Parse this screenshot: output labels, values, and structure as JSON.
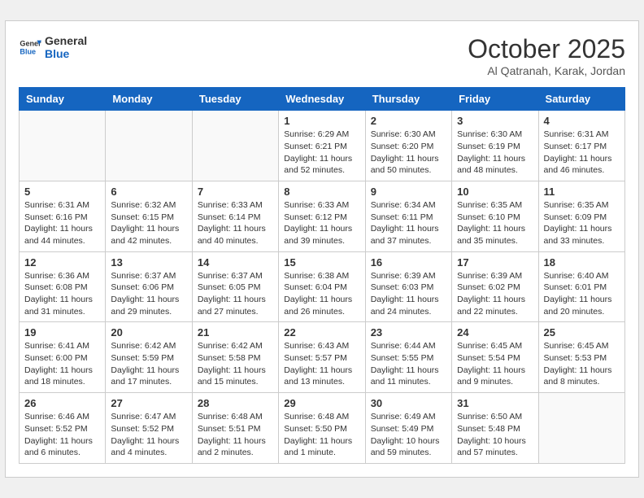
{
  "header": {
    "logo_line1": "General",
    "logo_line2": "Blue",
    "month_title": "October 2025",
    "location": "Al Qatranah, Karak, Jordan"
  },
  "days_of_week": [
    "Sunday",
    "Monday",
    "Tuesday",
    "Wednesday",
    "Thursday",
    "Friday",
    "Saturday"
  ],
  "weeks": [
    [
      {
        "day": "",
        "info": ""
      },
      {
        "day": "",
        "info": ""
      },
      {
        "day": "",
        "info": ""
      },
      {
        "day": "1",
        "info": "Sunrise: 6:29 AM\nSunset: 6:21 PM\nDaylight: 11 hours\nand 52 minutes."
      },
      {
        "day": "2",
        "info": "Sunrise: 6:30 AM\nSunset: 6:20 PM\nDaylight: 11 hours\nand 50 minutes."
      },
      {
        "day": "3",
        "info": "Sunrise: 6:30 AM\nSunset: 6:19 PM\nDaylight: 11 hours\nand 48 minutes."
      },
      {
        "day": "4",
        "info": "Sunrise: 6:31 AM\nSunset: 6:17 PM\nDaylight: 11 hours\nand 46 minutes."
      }
    ],
    [
      {
        "day": "5",
        "info": "Sunrise: 6:31 AM\nSunset: 6:16 PM\nDaylight: 11 hours\nand 44 minutes."
      },
      {
        "day": "6",
        "info": "Sunrise: 6:32 AM\nSunset: 6:15 PM\nDaylight: 11 hours\nand 42 minutes."
      },
      {
        "day": "7",
        "info": "Sunrise: 6:33 AM\nSunset: 6:14 PM\nDaylight: 11 hours\nand 40 minutes."
      },
      {
        "day": "8",
        "info": "Sunrise: 6:33 AM\nSunset: 6:12 PM\nDaylight: 11 hours\nand 39 minutes."
      },
      {
        "day": "9",
        "info": "Sunrise: 6:34 AM\nSunset: 6:11 PM\nDaylight: 11 hours\nand 37 minutes."
      },
      {
        "day": "10",
        "info": "Sunrise: 6:35 AM\nSunset: 6:10 PM\nDaylight: 11 hours\nand 35 minutes."
      },
      {
        "day": "11",
        "info": "Sunrise: 6:35 AM\nSunset: 6:09 PM\nDaylight: 11 hours\nand 33 minutes."
      }
    ],
    [
      {
        "day": "12",
        "info": "Sunrise: 6:36 AM\nSunset: 6:08 PM\nDaylight: 11 hours\nand 31 minutes."
      },
      {
        "day": "13",
        "info": "Sunrise: 6:37 AM\nSunset: 6:06 PM\nDaylight: 11 hours\nand 29 minutes."
      },
      {
        "day": "14",
        "info": "Sunrise: 6:37 AM\nSunset: 6:05 PM\nDaylight: 11 hours\nand 27 minutes."
      },
      {
        "day": "15",
        "info": "Sunrise: 6:38 AM\nSunset: 6:04 PM\nDaylight: 11 hours\nand 26 minutes."
      },
      {
        "day": "16",
        "info": "Sunrise: 6:39 AM\nSunset: 6:03 PM\nDaylight: 11 hours\nand 24 minutes."
      },
      {
        "day": "17",
        "info": "Sunrise: 6:39 AM\nSunset: 6:02 PM\nDaylight: 11 hours\nand 22 minutes."
      },
      {
        "day": "18",
        "info": "Sunrise: 6:40 AM\nSunset: 6:01 PM\nDaylight: 11 hours\nand 20 minutes."
      }
    ],
    [
      {
        "day": "19",
        "info": "Sunrise: 6:41 AM\nSunset: 6:00 PM\nDaylight: 11 hours\nand 18 minutes."
      },
      {
        "day": "20",
        "info": "Sunrise: 6:42 AM\nSunset: 5:59 PM\nDaylight: 11 hours\nand 17 minutes."
      },
      {
        "day": "21",
        "info": "Sunrise: 6:42 AM\nSunset: 5:58 PM\nDaylight: 11 hours\nand 15 minutes."
      },
      {
        "day": "22",
        "info": "Sunrise: 6:43 AM\nSunset: 5:57 PM\nDaylight: 11 hours\nand 13 minutes."
      },
      {
        "day": "23",
        "info": "Sunrise: 6:44 AM\nSunset: 5:55 PM\nDaylight: 11 hours\nand 11 minutes."
      },
      {
        "day": "24",
        "info": "Sunrise: 6:45 AM\nSunset: 5:54 PM\nDaylight: 11 hours\nand 9 minutes."
      },
      {
        "day": "25",
        "info": "Sunrise: 6:45 AM\nSunset: 5:53 PM\nDaylight: 11 hours\nand 8 minutes."
      }
    ],
    [
      {
        "day": "26",
        "info": "Sunrise: 6:46 AM\nSunset: 5:52 PM\nDaylight: 11 hours\nand 6 minutes."
      },
      {
        "day": "27",
        "info": "Sunrise: 6:47 AM\nSunset: 5:52 PM\nDaylight: 11 hours\nand 4 minutes."
      },
      {
        "day": "28",
        "info": "Sunrise: 6:48 AM\nSunset: 5:51 PM\nDaylight: 11 hours\nand 2 minutes."
      },
      {
        "day": "29",
        "info": "Sunrise: 6:48 AM\nSunset: 5:50 PM\nDaylight: 11 hours\nand 1 minute."
      },
      {
        "day": "30",
        "info": "Sunrise: 6:49 AM\nSunset: 5:49 PM\nDaylight: 10 hours\nand 59 minutes."
      },
      {
        "day": "31",
        "info": "Sunrise: 6:50 AM\nSunset: 5:48 PM\nDaylight: 10 hours\nand 57 minutes."
      },
      {
        "day": "",
        "info": ""
      }
    ]
  ]
}
